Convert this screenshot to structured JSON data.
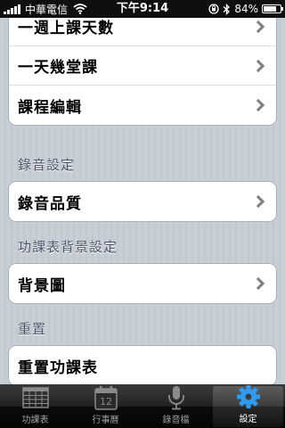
{
  "status_bar": {
    "carrier": "中華電信",
    "time": "下午9:14",
    "battery": "84%",
    "battery_level": 0.84
  },
  "groups": {
    "schedule": {
      "rows": [
        {
          "label": "一週上課天數"
        },
        {
          "label": "一天幾堂課"
        },
        {
          "label": "課程編輯"
        }
      ]
    },
    "recording": {
      "header": "錄音設定",
      "rows": [
        {
          "label": "錄音品質"
        }
      ]
    },
    "background": {
      "header": "功課表背景設定",
      "rows": [
        {
          "label": "背景圖"
        }
      ]
    },
    "reset": {
      "header": "重置",
      "rows": [
        {
          "label": "重置功課表"
        }
      ]
    }
  },
  "tab_bar": {
    "tabs": [
      {
        "label": "功課表",
        "icon": "grid-icon"
      },
      {
        "label": "行事曆",
        "icon": "calendar-icon",
        "icon_text": "12"
      },
      {
        "label": "錄音檔",
        "icon": "microphone-icon"
      },
      {
        "label": "設定",
        "icon": "gear-icon",
        "active": true
      }
    ]
  },
  "colors": {
    "active_icon": "#2f9bf2",
    "inactive_icon": "#8a8a8a",
    "section_header": "#4c566c"
  }
}
